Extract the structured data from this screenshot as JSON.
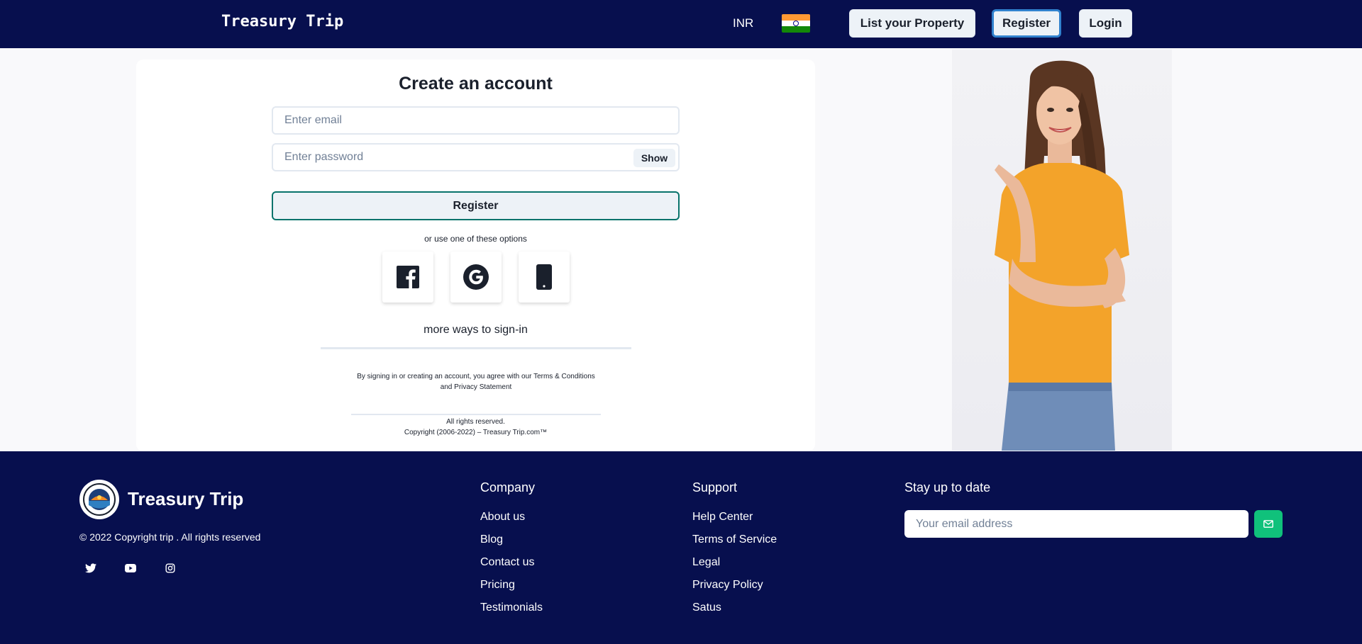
{
  "header": {
    "brand": "Treasury Trip",
    "currency": "INR",
    "flag_icon": "india-flag-icon",
    "list_property_label": "List your Property",
    "register_label": "Register",
    "login_label": "Login"
  },
  "form": {
    "title": "Create an account",
    "email_placeholder": "Enter email",
    "password_placeholder": "Enter password",
    "show_label": "Show",
    "register_label": "Register",
    "options_text": "or use one of these options",
    "social_icons": [
      "facebook-icon",
      "google-icon",
      "mobile-phone-icon"
    ],
    "more_ways": "more ways to sign-in",
    "terms_line1": "By signing in or creating an account, you agree with our Terms & Conditions",
    "terms_line2": "and Privacy Statement",
    "rights": "All rights reserved.",
    "copyright": "Copyright (2006-2022) – Treasury Trip.com™"
  },
  "footer": {
    "brand": "Treasury Trip",
    "copyright": "© 2022 Copyright trip . All rights reserved",
    "social_icons": [
      "twitter-icon",
      "youtube-icon",
      "instagram-icon"
    ],
    "company": {
      "heading": "Company",
      "links": [
        "About us",
        "Blog",
        "Contact us",
        "Pricing",
        "Testimonials"
      ]
    },
    "support": {
      "heading": "Support",
      "links": [
        "Help Center",
        "Terms of Service",
        "Legal",
        "Privacy Policy",
        "Satus"
      ]
    },
    "newsletter": {
      "heading": "Stay up to date",
      "placeholder": "Your email address",
      "send_icon": "mail-icon"
    }
  },
  "colors": {
    "navy": "#070f4e",
    "accent_teal": "#08736b",
    "register_focus": "#3182ce",
    "send_green": "#10c17b",
    "shirt_orange": "#f3a32a"
  }
}
